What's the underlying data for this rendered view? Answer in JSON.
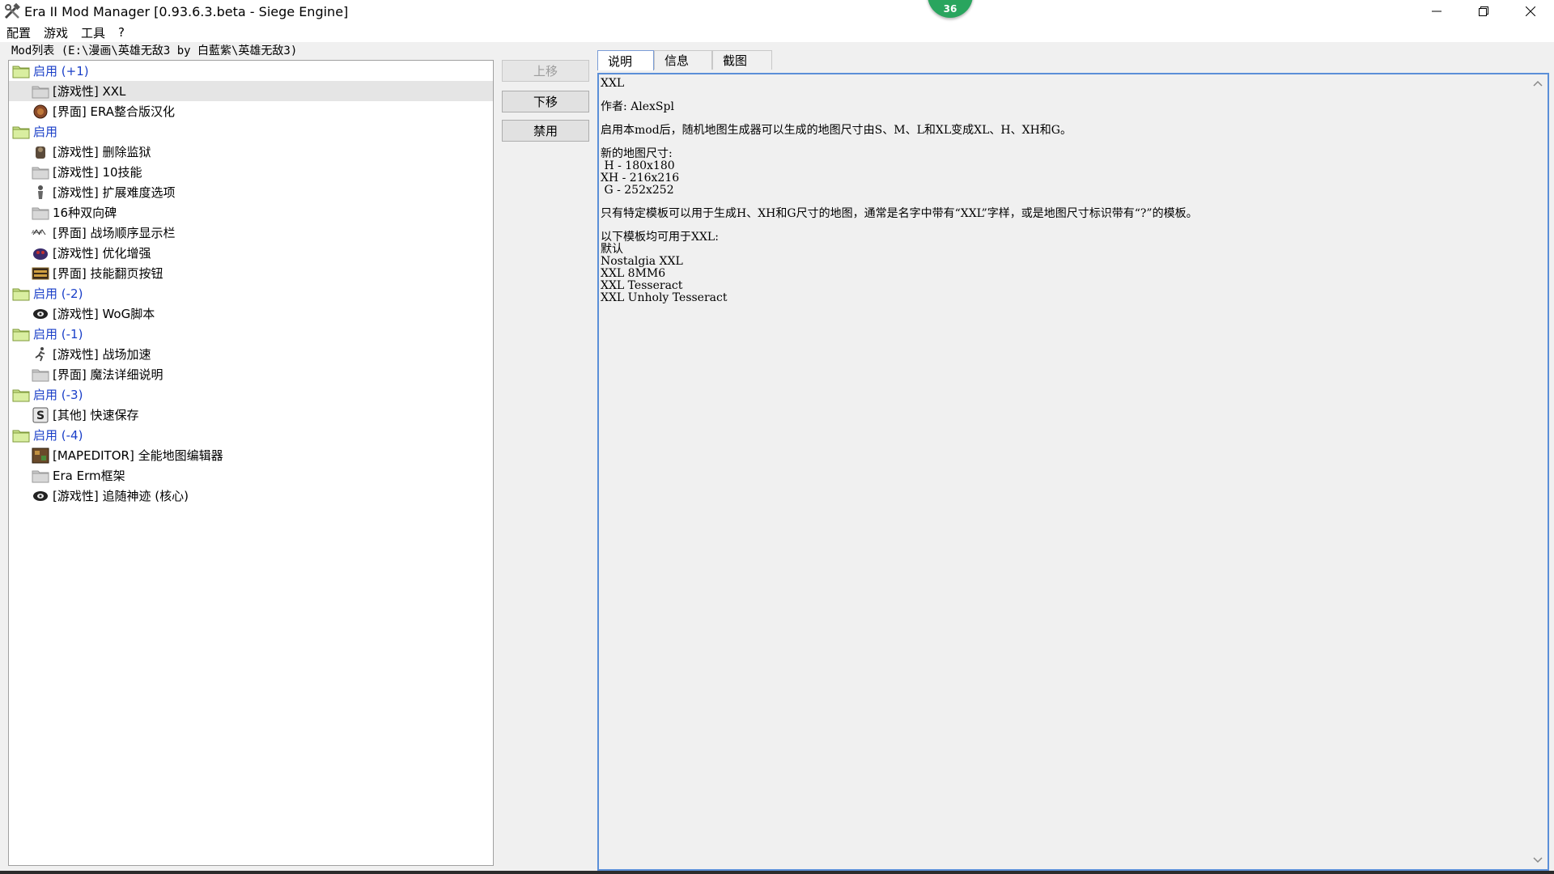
{
  "window": {
    "title": "Era II Mod Manager [0.93.6.3.beta - Siege Engine]",
    "badge": "36"
  },
  "menu": {
    "items": [
      "配置",
      "游戏",
      "工具",
      "?"
    ]
  },
  "path_label": "Mod列表 (E:\\漫画\\英雄无敌3 by 白藍紫\\英雄无敌3)",
  "tree": {
    "rows": [
      {
        "kind": "group",
        "label": "启用 (+1)"
      },
      {
        "kind": "item",
        "label": "[游戏性] XXL",
        "icon": "folder",
        "selected": true
      },
      {
        "kind": "item",
        "label": "[界面] ERA整合版汉化",
        "icon": "globe"
      },
      {
        "kind": "group",
        "label": "启用"
      },
      {
        "kind": "item",
        "label": "[游戏性] 删除监狱",
        "icon": "prisoner"
      },
      {
        "kind": "item",
        "label": "[游戏性] 10技能",
        "icon": "folder"
      },
      {
        "kind": "item",
        "label": "[游戏性] 扩展难度选项",
        "icon": "warrior"
      },
      {
        "kind": "item",
        "label": "16种双向碑",
        "icon": "folder"
      },
      {
        "kind": "item",
        "label": "[界面] 战场顺序显示栏",
        "icon": "sequence"
      },
      {
        "kind": "item",
        "label": "[游戏性] 优化增强",
        "icon": "creature"
      },
      {
        "kind": "item",
        "label": "[界面] 技能翻页按钮",
        "icon": "panel"
      },
      {
        "kind": "group",
        "label": "启用 (-2)"
      },
      {
        "kind": "item",
        "label": "[游戏性] WoG脚本",
        "icon": "wog"
      },
      {
        "kind": "group",
        "label": "启用 (-1)"
      },
      {
        "kind": "item",
        "label": "[游戏性] 战场加速",
        "icon": "runner"
      },
      {
        "kind": "item",
        "label": "[界面] 魔法详细说明",
        "icon": "folder"
      },
      {
        "kind": "group",
        "label": "启用 (-3)"
      },
      {
        "kind": "item",
        "label": "[其他] 快速保存",
        "icon": "save-s"
      },
      {
        "kind": "group",
        "label": "启用 (-4)"
      },
      {
        "kind": "item",
        "label": "[MAPEDITOR] 全能地图编辑器",
        "icon": "map"
      },
      {
        "kind": "item",
        "label": "Era Erm框架",
        "icon": "folder"
      },
      {
        "kind": "item",
        "label": "[游戏性] 追随神迹 (核心)",
        "icon": "wog"
      }
    ]
  },
  "buttons": {
    "up": "上移",
    "down": "下移",
    "disable": "禁用"
  },
  "tabs": [
    "说明",
    "信息",
    "截图"
  ],
  "description": {
    "lines": [
      "XXL",
      "",
      "作者: AlexSpl",
      "",
      "启用本mod后，随机地图生成器可以生成的地图尺寸由S、M、L和XL变成XL、H、XH和G。",
      "",
      "新的地图尺寸:",
      " H - 180x180",
      "XH - 216x216",
      " G - 252x252",
      "",
      "只有特定模板可以用于生成H、XH和G尺寸的地图，通常是名字中带有“XXL”字样，或是地图尺寸标识带有“?”的模板。",
      "",
      "以下模板均可用于XXL:",
      "默认",
      "Nostalgia XXL",
      "XXL 8MM6",
      "XXL Tesseract",
      "XXL Unholy Tesseract"
    ]
  }
}
